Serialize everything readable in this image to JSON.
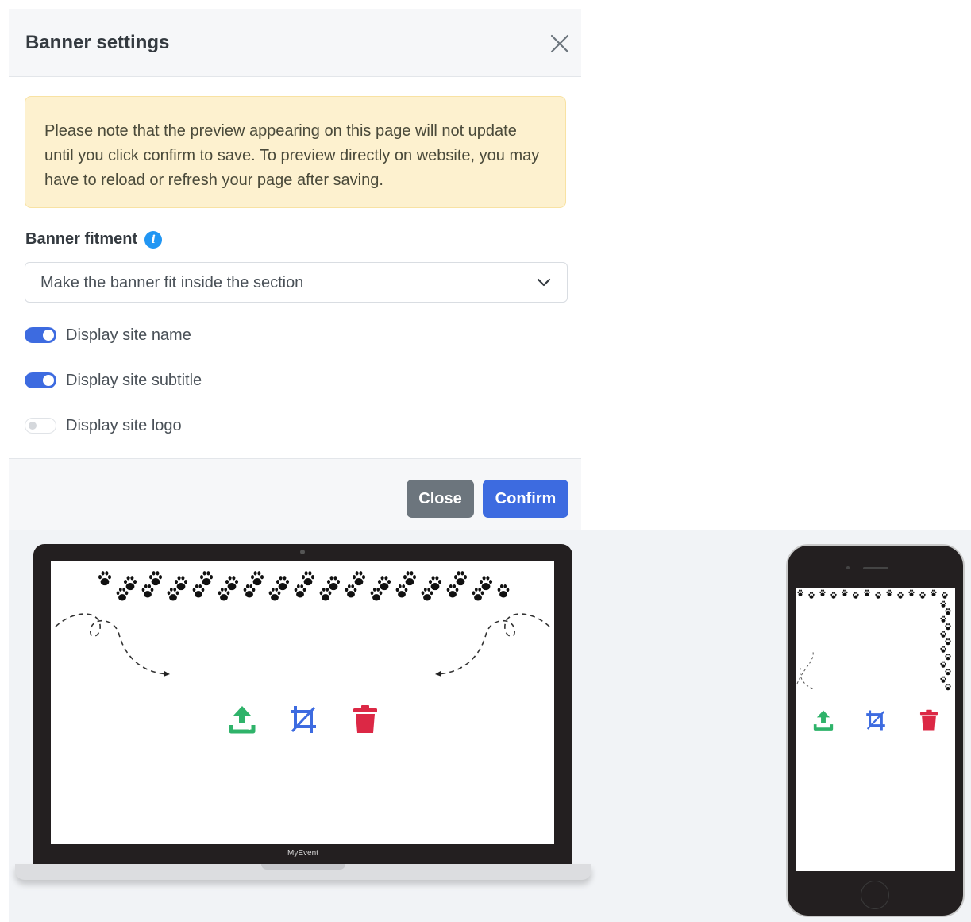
{
  "modal": {
    "title": "Banner settings",
    "notice": "Please note that the preview appearing on this page will not update until you click confirm to save. To preview directly on website, you may have to reload or refresh your page after saving.",
    "fitment": {
      "label": "Banner fitment",
      "selected": "Make the banner fit inside the section"
    },
    "toggles": [
      {
        "label": "Display site name",
        "on": true
      },
      {
        "label": "Display site subtitle",
        "on": true
      },
      {
        "label": "Display site logo",
        "on": false
      }
    ],
    "buttons": {
      "close": "Close",
      "confirm": "Confirm"
    }
  },
  "preview": {
    "laptop_caption": "MyEvent"
  },
  "colors": {
    "upload": "#2fb36a",
    "crop": "#3d6be0",
    "delete": "#dc2845",
    "primary": "#3d6be0",
    "secondary": "#6c757d",
    "notice_bg": "#fdf1cf"
  },
  "icons": {
    "close": "close-icon",
    "info": "info-icon",
    "chevron": "chevron-down-icon",
    "upload": "upload-icon",
    "crop": "crop-icon",
    "delete": "trash-icon"
  }
}
